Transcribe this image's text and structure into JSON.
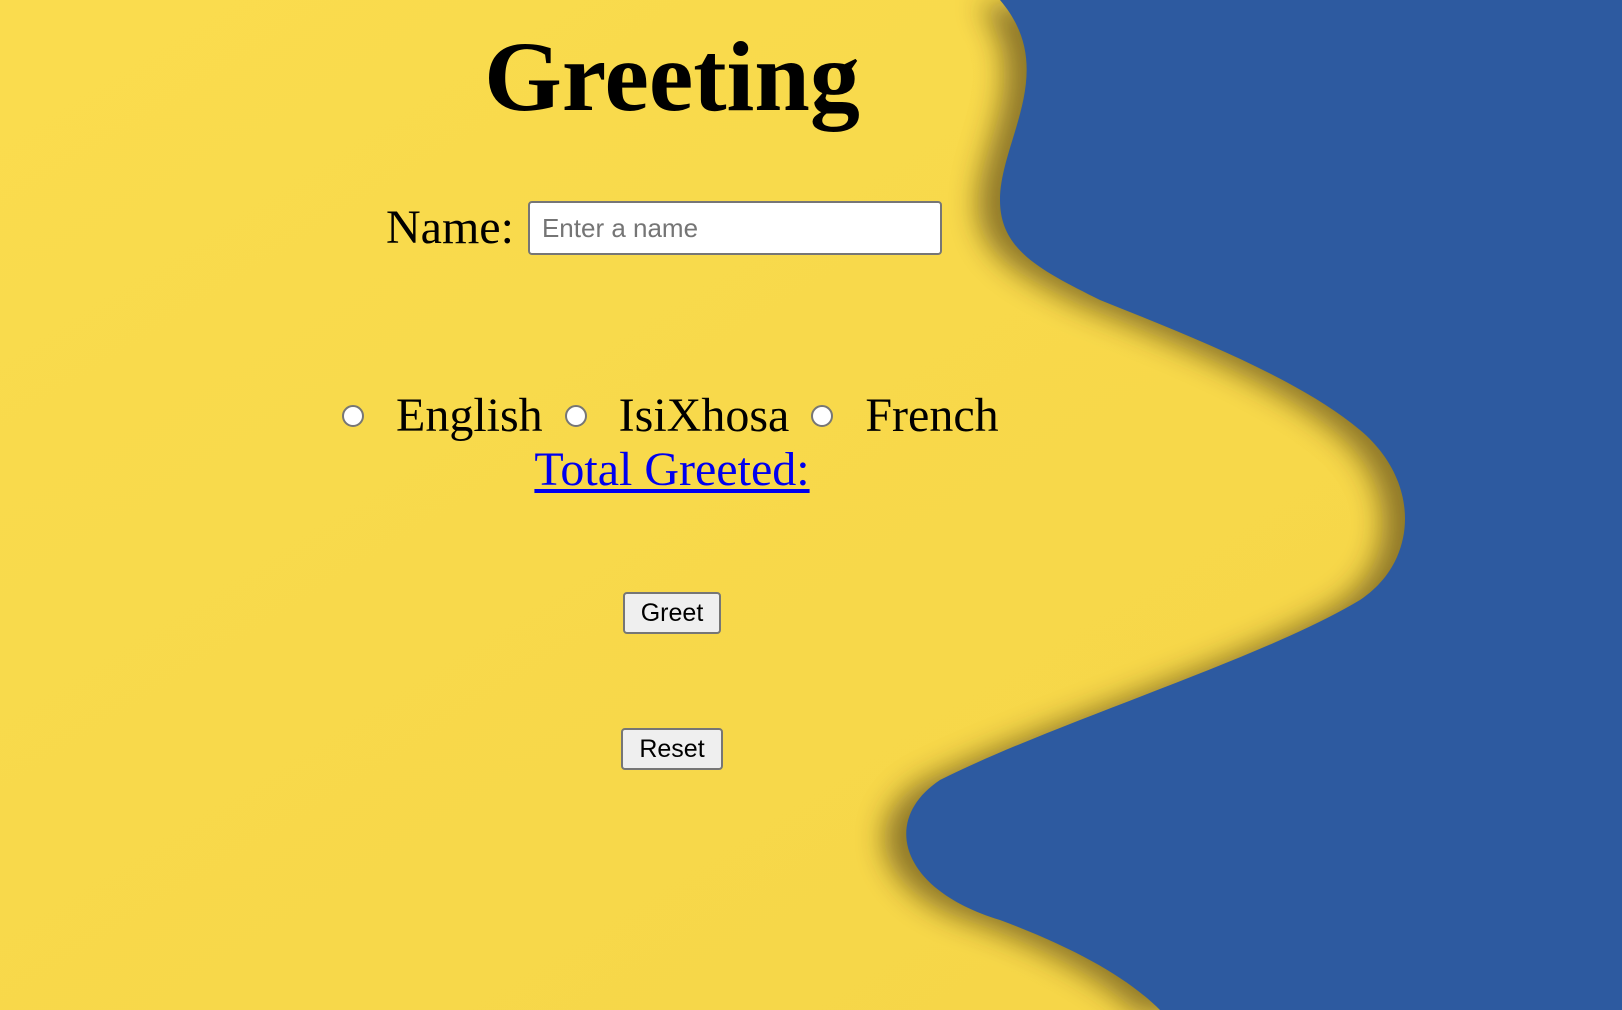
{
  "page": {
    "title": "Greeting"
  },
  "name_field": {
    "label": "Name:",
    "placeholder": "Enter a name",
    "value": ""
  },
  "languages": [
    {
      "label": "English",
      "selected": false
    },
    {
      "label": "IsiXhosa",
      "selected": false
    },
    {
      "label": "French",
      "selected": false
    }
  ],
  "counter": {
    "label": "Total Greeted:"
  },
  "buttons": {
    "greet_label": "Greet",
    "reset_label": "Reset"
  },
  "colors": {
    "background_yellow": "#f7d84b",
    "background_blue": "#2d5aa0",
    "link": "#0000ee"
  }
}
